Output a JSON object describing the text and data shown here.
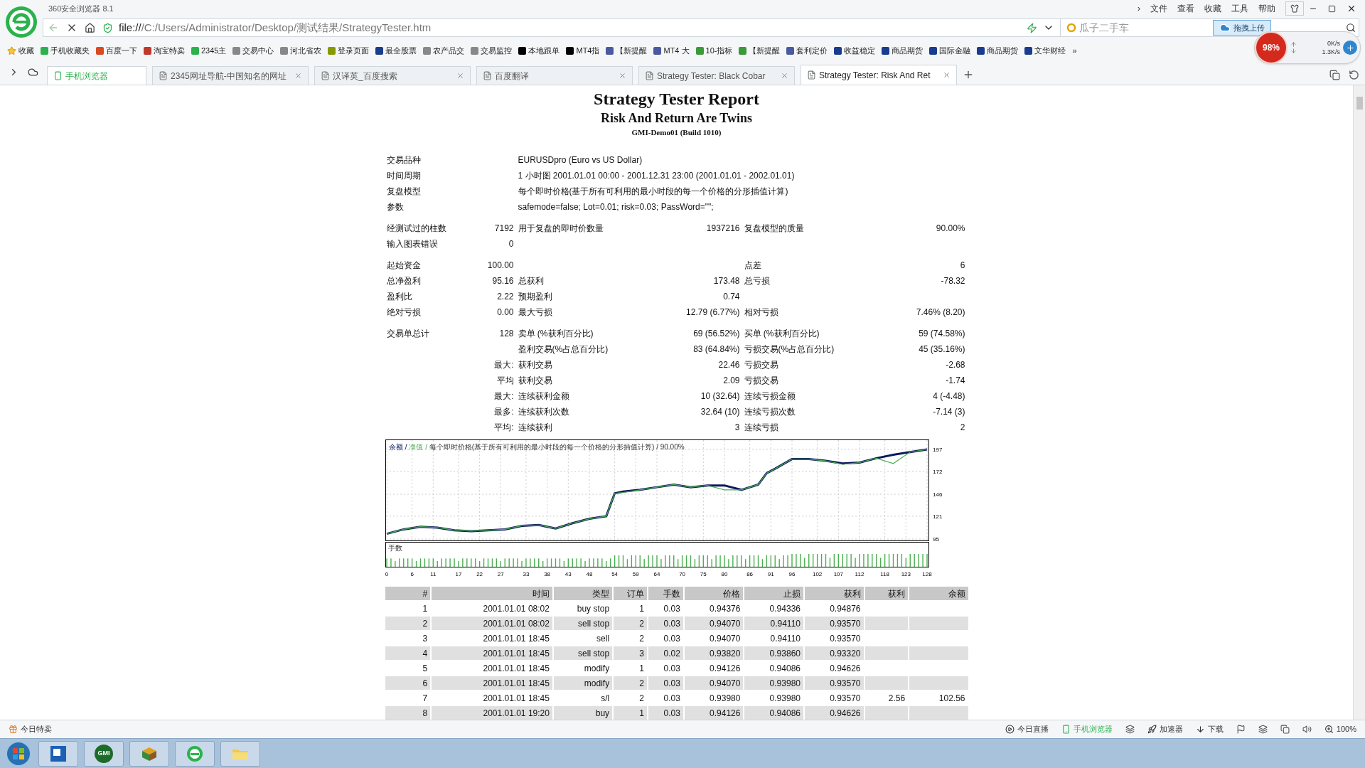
{
  "browser": {
    "title": "360安全浏览器 8.1",
    "menu": [
      "›",
      "文件",
      "查看",
      "收藏",
      "工具",
      "帮助"
    ],
    "address": {
      "scheme": "file://",
      "path": "/C:/Users/Administrator/Desktop/测试结果/StrategyTester.htm"
    },
    "search": {
      "placeholder": "瓜子二手车"
    },
    "upload_button": "拖拽上传",
    "speed": {
      "percent": "98%",
      "up": "0K/s",
      "down": "1.3K/s"
    },
    "bookmarks": [
      "收藏",
      "手机收藏夹",
      "百度一下",
      "淘宝特卖",
      "2345主",
      "交易中心",
      "河北省农",
      "登录页面",
      "最全股票",
      "农产品交",
      "交易监控",
      "本地跟单",
      "MT4指",
      "【新提醒",
      "MT4 大",
      "10-指标",
      "【新提醒",
      "套利定价",
      "收益稳定",
      "商品期货",
      "国际金融",
      "商品期货",
      "文华财经",
      "»"
    ],
    "mobile_tab": "手机浏览器",
    "tabs": [
      {
        "label": "2345网址导航-中国知名的网址",
        "selected": false
      },
      {
        "label": "汉译英_百度搜索",
        "selected": false
      },
      {
        "label": "百度翻译",
        "selected": false
      },
      {
        "label": "Strategy Tester: Black Cobar",
        "selected": false
      },
      {
        "label": "Strategy Tester: Risk And Ret",
        "selected": true
      }
    ]
  },
  "report": {
    "title": "Strategy Tester Report",
    "subtitle": "Risk And Return Are Twins",
    "server": "GMI-Demo01 (Build 1010)",
    "info": [
      {
        "label": "交易品种",
        "value": "EURUSDpro (Euro vs US Dollar)"
      },
      {
        "label": "时间周期",
        "value": "1 小时图 2001.01.01 00:00 - 2001.12.31 23:00 (2001.01.01 - 2002.01.01)"
      },
      {
        "label": "复盘模型",
        "value": "每个即时价格(基于所有可利用的最小时段的每一个价格的分形插值计算)"
      },
      {
        "label": "参数",
        "value": "safemode=false; Lot=0.01; risk=0.03; PassWord=\"\";"
      }
    ],
    "stat_groups": [
      [
        {
          "label_1": "经测试过的柱数",
          "value_1": "7192",
          "label_2": "用于复盘的即时价数量",
          "value_2": "1937216",
          "label_3": "复盘模型的质量",
          "value_3": "90.00%"
        },
        {
          "label_1": "输入图表错误",
          "value_1": "0"
        }
      ],
      [
        {
          "label_1": "起始资金",
          "value_1": "100.00",
          "label_3": "点差",
          "value_3": "6"
        },
        {
          "label_1": "总净盈利",
          "value_1": "95.16",
          "label_2": "总获利",
          "value_2": "173.48",
          "label_3": "总亏损",
          "value_3": "-78.32"
        },
        {
          "label_1": "盈利比",
          "value_1": "2.22",
          "label_2": "预期盈利",
          "value_2": "0.74"
        },
        {
          "label_1": "绝对亏损",
          "value_1": "0.00",
          "label_2": "最大亏损",
          "value_2": "12.79 (6.77%)",
          "label_3": "相对亏损",
          "value_3": "7.46% (8.20)"
        }
      ],
      [
        {
          "label_1": "交易单总计",
          "value_1": "128",
          "label_2": "卖单 (%获利百分比)",
          "value_2": "69 (56.52%)",
          "label_3": "买单 (%获利百分比)",
          "value_3": "59 (74.58%)"
        },
        {
          "label_2": "盈利交易(%占总百分比)",
          "value_2": "83 (64.84%)",
          "label_3": "亏损交易(%占总百分比)",
          "value_3": "45 (35.16%)"
        },
        {
          "value_1": "最大:",
          "label_2": "获利交易",
          "value_2": "22.46",
          "label_3": "亏损交易",
          "value_3": "-2.68"
        },
        {
          "value_1": "平均",
          "label_2": "获利交易",
          "value_2": "2.09",
          "label_3": "亏损交易",
          "value_3": "-1.74"
        },
        {
          "value_1": "最大:",
          "label_2": "连续获利金额",
          "value_2": "10 (32.64)",
          "label_3": "连续亏损金额",
          "value_3": "4 (-4.48)"
        },
        {
          "value_1": "最多:",
          "label_2": "连续获利次数",
          "value_2": "32.64 (10)",
          "label_3": "连续亏损次数",
          "value_3": "-7.14 (3)"
        },
        {
          "value_1": "平均:",
          "label_2": "连续获利",
          "value_2": "3",
          "label_3": "连续亏损",
          "value_3": "2"
        }
      ]
    ],
    "chart": {
      "legend_separator": "/",
      "legend": [
        "每个即时价格(基于所有可利用的最小时段的每一个价格的分形插值计算)",
        "90.00%"
      ],
      "lots_label": "手数",
      "chart_data": {
        "type": "line",
        "grid": true,
        "x": [
          0,
          4,
          8,
          12,
          16,
          20,
          24,
          28,
          32,
          36,
          40,
          44,
          48,
          52,
          54,
          56,
          60,
          64,
          68,
          72,
          76,
          80,
          84,
          88,
          90,
          92,
          96,
          100,
          104,
          108,
          112,
          116,
          120,
          124,
          128
        ],
        "series": [
          {
            "name": "余额",
            "color": "#0b1a5c",
            "values": [
              101,
              106,
              109,
              108,
              105,
              104,
              105,
              106,
              110,
              111,
              107,
              113,
              118,
              121,
              147,
              149,
              151,
              154,
              157,
              154,
              156,
              156,
              151,
              157,
              170,
              175,
              186,
              186,
              184,
              181,
              182,
              187,
              191,
              194,
              197
            ]
          },
          {
            "name": "净值",
            "color": "#4caf50",
            "values": [
              101,
              106,
              109,
              108,
              105,
              104,
              105,
              106,
              110,
              111,
              107,
              113,
              118,
              121,
              147,
              148,
              151,
              154,
              157,
              154,
              156,
              151,
              151,
              157,
              170,
              175,
              186,
              186,
              184,
              180,
              182,
              187,
              181,
              194,
              197
            ]
          }
        ],
        "ylim": [
          95,
          197
        ],
        "xlim": [
          0,
          128
        ],
        "yticks": [
          95,
          121,
          146,
          172,
          197
        ],
        "xticks": [
          0,
          6,
          11,
          17,
          22,
          27,
          33,
          38,
          43,
          48,
          54,
          59,
          64,
          70,
          75,
          80,
          86,
          91,
          96,
          102,
          107,
          112,
          118,
          123,
          128
        ]
      }
    },
    "trades": {
      "columns": [
        "#",
        "时间",
        "类型",
        "订单",
        "手数",
        "价格",
        "止损",
        "获利",
        "获利",
        "余额"
      ],
      "rows": [
        [
          "1",
          "2001.01.01 08:02",
          "buy stop",
          "1",
          "0.03",
          "0.94376",
          "0.94336",
          "0.94876"
        ],
        [
          "2",
          "2001.01.01 08:02",
          "sell stop",
          "2",
          "0.03",
          "0.94070",
          "0.94110",
          "0.93570"
        ],
        [
          "3",
          "2001.01.01 18:45",
          "sell",
          "2",
          "0.03",
          "0.94070",
          "0.94110",
          "0.93570"
        ],
        [
          "4",
          "2001.01.01 18:45",
          "sell stop",
          "3",
          "0.02",
          "0.93820",
          "0.93860",
          "0.93320"
        ],
        [
          "5",
          "2001.01.01 18:45",
          "modify",
          "1",
          "0.03",
          "0.94126",
          "0.94086",
          "0.94626"
        ],
        [
          "6",
          "2001.01.01 18:45",
          "modify",
          "2",
          "0.03",
          "0.94070",
          "0.93980",
          "0.93570"
        ],
        [
          "7",
          "2001.01.01 18:45",
          "s/l",
          "2",
          "0.03",
          "0.93980",
          "0.93980",
          "0.93570",
          "2.56",
          "102.56"
        ],
        [
          "8",
          "2001.01.01 19:20",
          "buy",
          "1",
          "0.03",
          "0.94126",
          "0.94086",
          "0.94626"
        ]
      ]
    }
  },
  "status_bar": {
    "left": "今日特卖",
    "right": [
      {
        "kind": "text-icon",
        "label": "今日直播"
      },
      {
        "kind": "text-icon",
        "label": "手机浏览器"
      },
      {
        "kind": "icon"
      },
      {
        "kind": "text-icon",
        "label": "加速器"
      },
      {
        "kind": "text-icon",
        "label": "下载"
      },
      {
        "kind": "icon"
      },
      {
        "kind": "icon"
      },
      {
        "kind": "icon"
      },
      {
        "kind": "icon"
      },
      {
        "kind": "text-icon",
        "label": "100%"
      }
    ]
  },
  "taskbar": {
    "apps": [
      {
        "kind": "window"
      },
      {
        "kind": "badge",
        "label": "GMI"
      },
      {
        "kind": "box"
      },
      {
        "kind": "browser"
      },
      {
        "kind": "folder"
      }
    ]
  }
}
